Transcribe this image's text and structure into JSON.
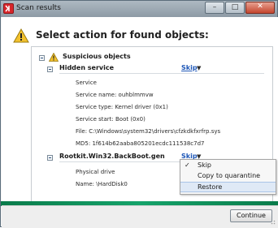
{
  "window": {
    "title": "Scan results",
    "controls": {
      "minimize": "–",
      "maximize": "□",
      "close": "✕"
    }
  },
  "header": {
    "text": "Select action for found objects:"
  },
  "group": {
    "label": "Suspicious objects",
    "items": [
      {
        "name": "Hidden service",
        "action": "Skip",
        "details": [
          "Service",
          "Service name: ouhblmmvw",
          "Service type: Kernel driver (0x1)",
          "Service start: Boot (0x0)",
          "File: C:\\Windows\\system32\\drivers\\cfzkdkfxrfrp.sys",
          "MD5: 1f614b62aaba805201ecdc111538c7d7"
        ]
      },
      {
        "name": "Rootkit.Win32.BackBoot.gen",
        "action": "Skip",
        "details": [
          "Physical drive",
          "Name: \\HardDisk0"
        ]
      }
    ]
  },
  "action_menu": {
    "items": [
      {
        "label": "Skip",
        "checked": true,
        "highlighted": false
      },
      {
        "label": "Copy to quarantine",
        "checked": false,
        "highlighted": false
      },
      {
        "label": "Restore",
        "checked": false,
        "highlighted": true
      }
    ]
  },
  "footer": {
    "continue_label": "Continue"
  },
  "colors": {
    "accent_green": "#15a36a",
    "link_blue": "#1f58b8",
    "warning_yellow": "#f2c12e"
  }
}
